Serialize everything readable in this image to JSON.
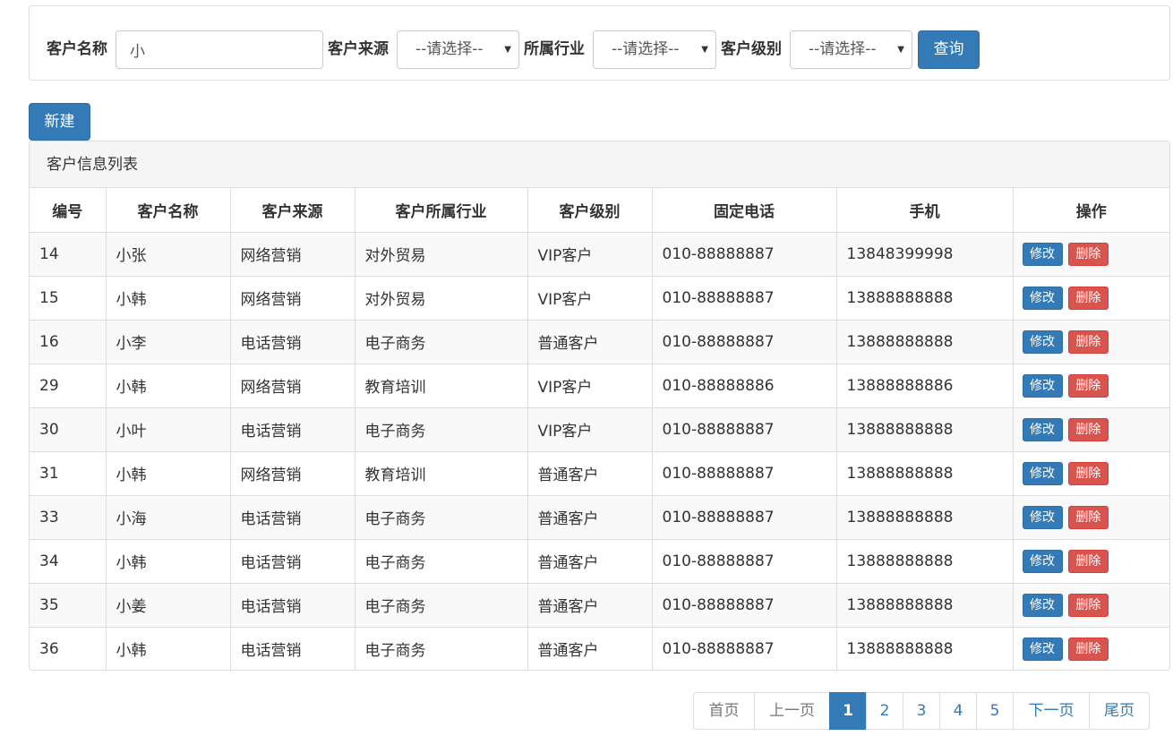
{
  "search": {
    "name_label": "客户名称",
    "name_value": "小",
    "source_label": "客户来源",
    "source_value": "--请选择--",
    "industry_label": "所属行业",
    "industry_value": "--请选择--",
    "level_label": "客户级别",
    "level_value": "--请选择--",
    "query_label": "查询"
  },
  "new_label": "新建",
  "panel_title": "客户信息列表",
  "columns": [
    "编号",
    "客户名称",
    "客户来源",
    "客户所属行业",
    "客户级别",
    "固定电话",
    "手机",
    "操作"
  ],
  "rows": [
    [
      "14",
      "小张",
      "网络营销",
      "对外贸易",
      "VIP客户",
      "010-88888887",
      "13848399998"
    ],
    [
      "15",
      "小韩",
      "网络营销",
      "对外贸易",
      "VIP客户",
      "010-88888887",
      "13888888888"
    ],
    [
      "16",
      "小李",
      "电话营销",
      "电子商务",
      "普通客户",
      "010-88888887",
      "13888888888"
    ],
    [
      "29",
      "小韩",
      "网络营销",
      "教育培训",
      "VIP客户",
      "010-88888886",
      "13888888886"
    ],
    [
      "30",
      "小叶",
      "电话营销",
      "电子商务",
      "VIP客户",
      "010-88888887",
      "13888888888"
    ],
    [
      "31",
      "小韩",
      "网络营销",
      "教育培训",
      "普通客户",
      "010-88888887",
      "13888888888"
    ],
    [
      "33",
      "小海",
      "电话营销",
      "电子商务",
      "普通客户",
      "010-88888887",
      "13888888888"
    ],
    [
      "34",
      "小韩",
      "电话营销",
      "电子商务",
      "普通客户",
      "010-88888887",
      "13888888888"
    ],
    [
      "35",
      "小姜",
      "电话营销",
      "电子商务",
      "普通客户",
      "010-88888887",
      "13888888888"
    ],
    [
      "36",
      "小韩",
      "电话营销",
      "电子商务",
      "普通客户",
      "010-88888887",
      "13888888888"
    ]
  ],
  "edit_label": "修改",
  "delete_label": "删除",
  "pagination": [
    {
      "label": "首页",
      "state": "disabled"
    },
    {
      "label": "上一页",
      "state": "disabled"
    },
    {
      "label": "1",
      "state": "active"
    },
    {
      "label": "2",
      "state": "normal"
    },
    {
      "label": "3",
      "state": "normal"
    },
    {
      "label": "4",
      "state": "normal"
    },
    {
      "label": "5",
      "state": "normal"
    },
    {
      "label": "下一页",
      "state": "normal"
    },
    {
      "label": "尾页",
      "state": "normal"
    }
  ],
  "colors": {
    "primary": "#337ab7",
    "danger": "#d9534f",
    "border": "#dddddd",
    "stripe": "#f9f9f9"
  }
}
